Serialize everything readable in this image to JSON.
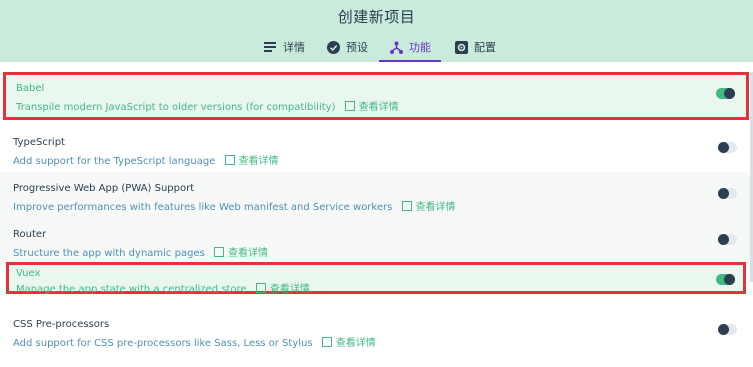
{
  "header": {
    "title": "创建新项目",
    "tabs": [
      {
        "label": "详情",
        "icon": "list-icon"
      },
      {
        "label": "预设",
        "icon": "check-circle-icon"
      },
      {
        "label": "功能",
        "icon": "fork-icon",
        "active": true
      },
      {
        "label": "配置",
        "icon": "gear-icon"
      }
    ]
  },
  "colors": {
    "accent_green": "#42b983",
    "accent_purple": "#6a35c2",
    "highlight_red": "#e8303a",
    "header_bg": "#c8ebdc"
  },
  "features": [
    {
      "name": "Babel",
      "description": "Transpile modern JavaScript to older versions (for compatibility)",
      "link": "查看详情",
      "enabled": true
    },
    {
      "name": "TypeScript",
      "description": "Add support for the TypeScript language",
      "link": "查看详情",
      "enabled": false
    },
    {
      "name": "Progressive Web App (PWA) Support",
      "description": "Improve performances with features like Web manifest and Service workers",
      "link": "查看详情",
      "enabled": false
    },
    {
      "name": "Router",
      "description": "Structure the app with dynamic pages",
      "link": "查看详情",
      "enabled": false
    },
    {
      "name": "Vuex",
      "description": "Manage the app state with a centralized store",
      "link": "查看详情",
      "enabled": true
    },
    {
      "name": "CSS Pre-processors",
      "description": "Add support for CSS pre-processors like Sass, Less or Stylus",
      "link": "查看详情",
      "enabled": false
    }
  ]
}
